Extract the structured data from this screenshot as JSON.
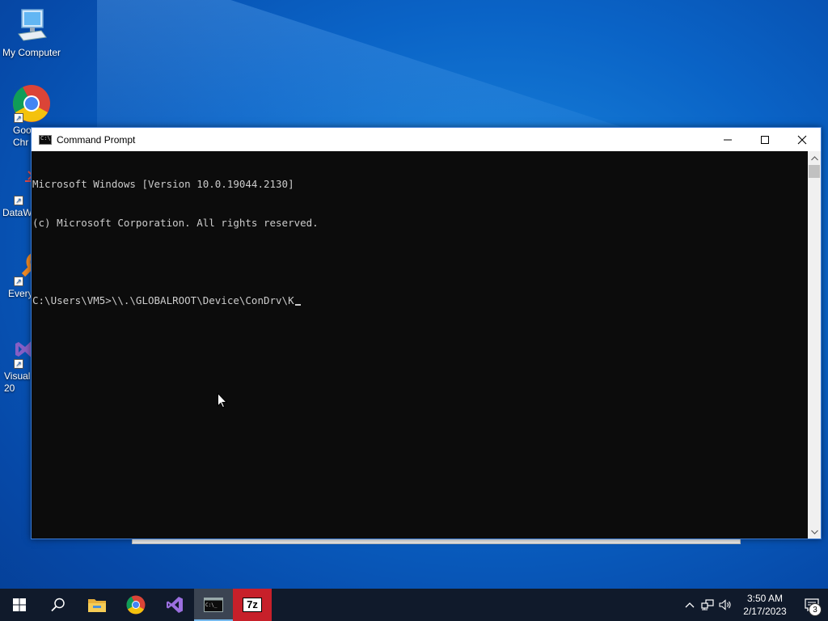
{
  "desktop": {
    "icons": [
      {
        "label": "My Computer",
        "icon": "computer-icon"
      },
      {
        "label": "Goo\nChr",
        "icon": "chrome-icon"
      },
      {
        "label": "DataW",
        "icon": "datawrapper-icon"
      },
      {
        "label": "Every",
        "icon": "everything-icon"
      },
      {
        "label": "Visual\n20",
        "icon": "visual-studio-icon"
      }
    ]
  },
  "window": {
    "title": "Command Prompt",
    "console_lines": [
      "Microsoft Windows [Version 10.0.19044.2130]",
      "(c) Microsoft Corporation. All rights reserved.",
      "",
      "C:\\Users\\VM5>\\\\.\\GLOBALROOT\\Device\\ConDrv\\K"
    ]
  },
  "taskbar": {
    "items": [
      "start-icon",
      "search-icon",
      "file-explorer-icon",
      "chrome-icon",
      "visual-studio-icon",
      "command-prompt-icon",
      "7zip-icon"
    ],
    "sevenzip_label": "7z",
    "clock": {
      "time": "3:50 AM",
      "date": "2/17/2023"
    },
    "notification_count": "3"
  },
  "colors": {
    "desktop_blue": "#0a63c6",
    "console_bg": "#0c0c0c",
    "console_text": "#cccccc",
    "taskbar": "#101a2b",
    "sevenzip_red": "#c7202a"
  }
}
